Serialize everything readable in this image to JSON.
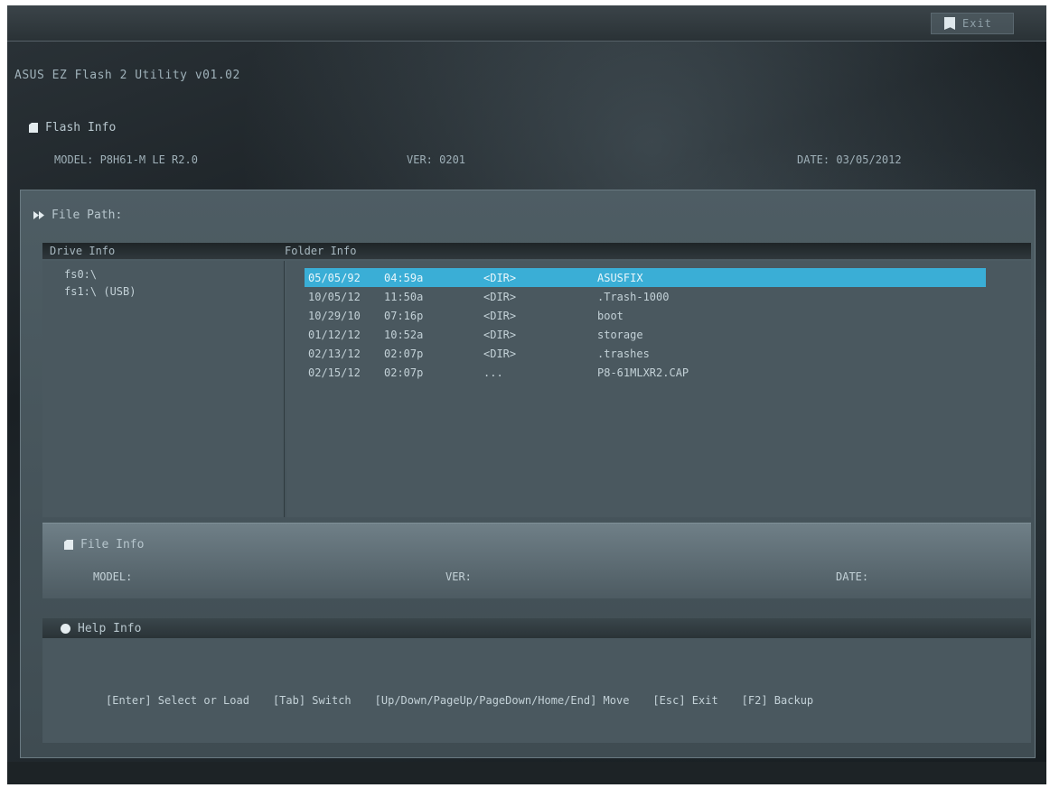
{
  "topbar": {
    "exit_label": "Exit"
  },
  "app_title": "ASUS EZ Flash 2 Utility v01.02",
  "flash_info": {
    "title": "Flash Info",
    "model": "MODEL: P8H61-M LE R2.0",
    "ver": "VER: 0201",
    "date": "DATE: 03/05/2012"
  },
  "file_path": {
    "title": "File Path:",
    "drive_header": "Drive Info",
    "folder_header": "Folder Info",
    "drives": [
      "fs0:\\",
      "fs1:\\ (USB)"
    ],
    "folders": [
      {
        "date": "05/05/92",
        "time": "04:59a",
        "type": "<DIR>",
        "name": "ASUSFIX",
        "selected": true
      },
      {
        "date": "10/05/12",
        "time": "11:50a",
        "type": "<DIR>",
        "name": ".Trash-1000",
        "selected": false
      },
      {
        "date": "10/29/10",
        "time": "07:16p",
        "type": "<DIR>",
        "name": "boot",
        "selected": false
      },
      {
        "date": "01/12/12",
        "time": "10:52a",
        "type": "<DIR>",
        "name": "storage",
        "selected": false
      },
      {
        "date": "02/13/12",
        "time": "02:07p",
        "type": "<DIR>",
        "name": ".trashes",
        "selected": false
      },
      {
        "date": "02/15/12",
        "time": "02:07p",
        "type": "...",
        "name": "P8-61MLXR2.CAP",
        "selected": false
      }
    ]
  },
  "file_info": {
    "title": "File Info",
    "model": "MODEL:",
    "ver": "VER:",
    "date": "DATE:"
  },
  "help_info": {
    "title": "Help Info",
    "keys": [
      "[Enter] Select or Load",
      "[Tab] Switch",
      "[Up/Down/PageUp/PageDown/Home/End] Move",
      "[Esc] Exit",
      "[F2] Backup"
    ]
  }
}
